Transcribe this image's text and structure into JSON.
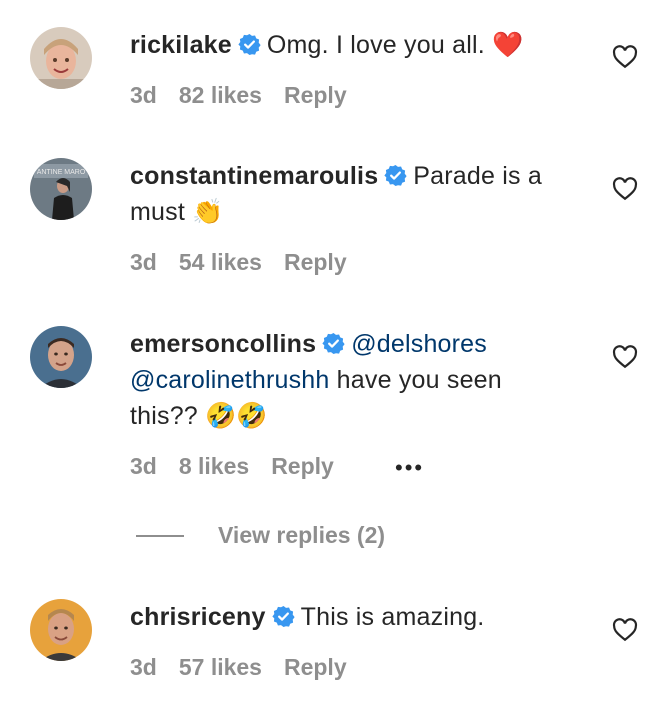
{
  "comments": [
    {
      "username": "rickilake",
      "text": "Omg. I love you all. ",
      "emoji": "❤️",
      "time": "3d",
      "likes": "82 likes",
      "reply": "Reply"
    },
    {
      "username": "constantinemaroulis",
      "text": "Parade is a must ",
      "emoji": "👏",
      "time": "3d",
      "likes": "54 likes",
      "reply": "Reply"
    },
    {
      "username": "emersoncollins",
      "mention1": "@delshores",
      "mention2": "@carolinethrushh",
      "text": " have you seen this?? ",
      "emoji": "🤣🤣",
      "time": "3d",
      "likes": "8 likes",
      "reply": "Reply",
      "more": "•••"
    },
    {
      "username": "chrisriceny",
      "text": "This is amazing.",
      "time": "3d",
      "likes": "57 likes",
      "reply": "Reply"
    }
  ],
  "view_replies": "View replies (2)",
  "colors": {
    "verified": "#3897f0",
    "mention": "#00376b",
    "muted": "#8e8e8e"
  }
}
